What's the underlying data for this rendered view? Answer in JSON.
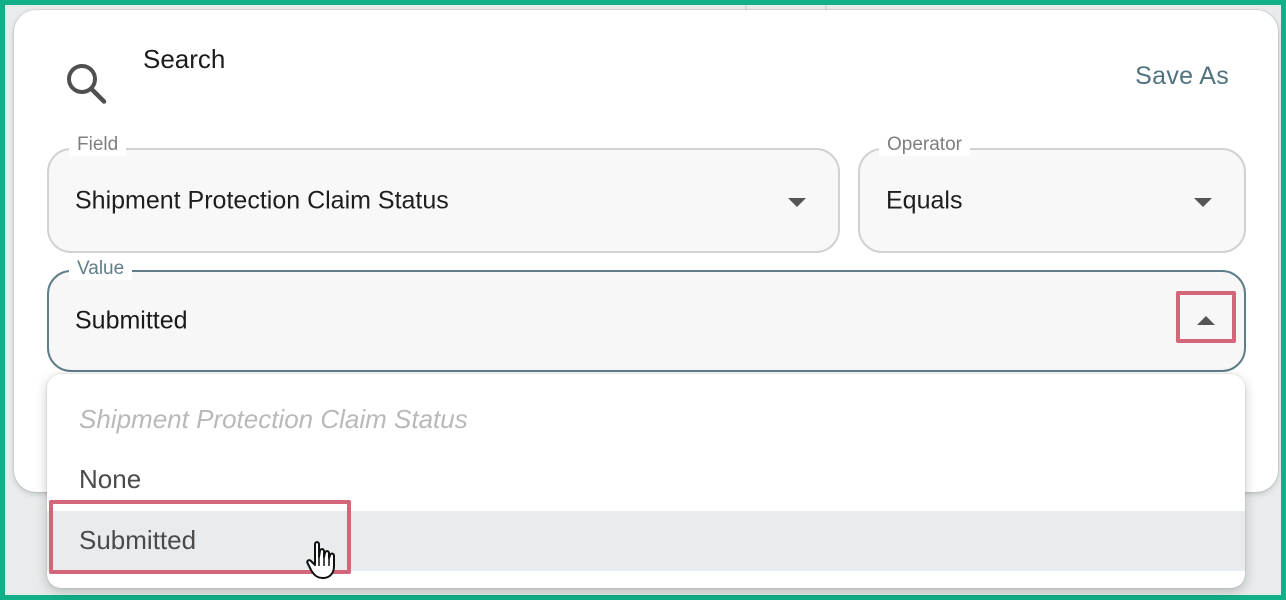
{
  "search": {
    "title": "Search",
    "icon": "search-icon"
  },
  "toolbar": {
    "save_as_label": "Save As"
  },
  "filters": {
    "field": {
      "legend": "Field",
      "value": "Shipment Protection Claim Status"
    },
    "operator": {
      "legend": "Operator",
      "value": "Equals"
    },
    "value": {
      "legend": "Value",
      "value": "Submitted"
    }
  },
  "dropdown": {
    "placeholder": "Shipment Protection Claim Status",
    "options": [
      "None",
      "Submitted"
    ],
    "selected": "Submitted"
  },
  "colors": {
    "frame": "#12b089",
    "accent": "#5f7d8a",
    "highlight": "#d16778",
    "selected_row": "#e8ecee"
  }
}
